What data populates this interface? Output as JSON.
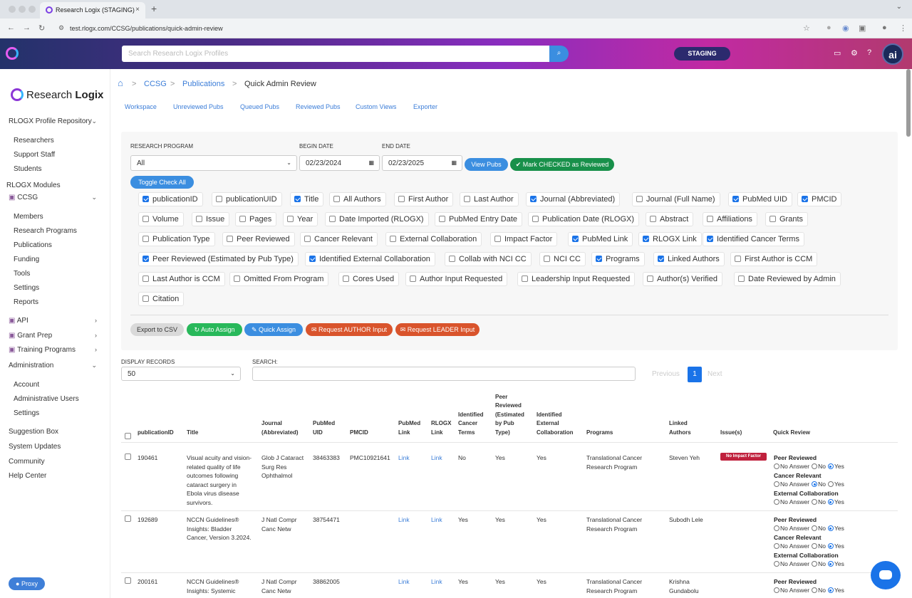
{
  "browser": {
    "tab_title": "Research Logix (STAGING)",
    "tab_close": "×",
    "new_tab": "+",
    "url": "test.rlogx.com/CCSG/publications/quick-admin-review",
    "back_icon": "←",
    "forward_icon": "→",
    "reload_icon": "↻",
    "site_icon": "⚙",
    "star_icon": "☆",
    "menu_chevron": "⌄"
  },
  "header": {
    "search_placeholder": "Search Research Logix Profiles",
    "search_icon": "⌕",
    "env_badge": "STAGING",
    "ai_badge": "ai",
    "icons": {
      "chat": "▭",
      "gear": "⚙",
      "help": "?"
    }
  },
  "sidebar": {
    "brand_light": "Research",
    "brand_bold": "Logix",
    "repo_label": "RLOGX Profile Repository",
    "repo_items": [
      "Researchers",
      "Support Staff",
      "Students"
    ],
    "modules_label": "RLOGX Modules",
    "ccsg_label": "CCSG",
    "ccsg_items": [
      "Members",
      "Research Programs",
      "Publications",
      "Funding",
      "Tools",
      "Settings",
      "Reports"
    ],
    "api_label": "API",
    "grant_prep_label": "Grant Prep",
    "training_label": "Training Programs",
    "admin_label": "Administration",
    "admin_items": [
      "Account",
      "Administrative Users",
      "Settings"
    ],
    "bottom_items": [
      "Suggestion Box",
      "System Updates",
      "Community",
      "Help Center"
    ],
    "proxy_label": "Proxy",
    "arrow_down": "⌄",
    "arrow_right": "›"
  },
  "breadcrumb": {
    "home_icon": "⌂",
    "sep": ">",
    "items": [
      "CCSG",
      "Publications",
      "Quick Admin Review"
    ]
  },
  "subtabs": [
    "Workspace",
    "Unreviewed Pubs",
    "Queued Pubs",
    "Reviewed Pubs",
    "Custom Views",
    "Exporter"
  ],
  "filters": {
    "program_label": "RESEARCH PROGRAM",
    "program_value": "All",
    "begin_label": "BEGIN DATE",
    "begin_value": "02/23/2024",
    "end_label": "END DATE",
    "end_value": "02/23/2025",
    "calendar_icon": "▦",
    "caret": "⌄",
    "view_pubs": "View Pubs",
    "mark_checked": "Mark CHECKED as Reviewed",
    "toggle_all": "Toggle Check All",
    "columns": [
      {
        "label": "publicationID",
        "checked": true
      },
      {
        "label": "publicationUID",
        "checked": false
      },
      {
        "label": "Title",
        "checked": true
      },
      {
        "label": "All Authors",
        "checked": false
      },
      {
        "label": "First Author",
        "checked": false
      },
      {
        "label": "Last Author",
        "checked": false
      },
      {
        "label": "Journal (Abbreviated)",
        "checked": true
      },
      {
        "label": "Journal (Full Name)",
        "checked": false
      },
      {
        "label": "PubMed UID",
        "checked": true
      },
      {
        "label": "PMCID",
        "checked": true
      },
      {
        "label": "Volume",
        "checked": false
      },
      {
        "label": "Issue",
        "checked": false
      },
      {
        "label": "Pages",
        "checked": false
      },
      {
        "label": "Year",
        "checked": false
      },
      {
        "label": "Date Imported (RLOGX)",
        "checked": false
      },
      {
        "label": "PubMed Entry Date",
        "checked": false
      },
      {
        "label": "Publication Date (RLOGX)",
        "checked": false
      },
      {
        "label": "Abstract",
        "checked": false
      },
      {
        "label": "Affiliations",
        "checked": false
      },
      {
        "label": "Grants",
        "checked": false
      },
      {
        "label": "Publication Type",
        "checked": false
      },
      {
        "label": "Peer Reviewed",
        "checked": false
      },
      {
        "label": "Cancer Relevant",
        "checked": false
      },
      {
        "label": "External Collaboration",
        "checked": false
      },
      {
        "label": "Impact Factor",
        "checked": false
      },
      {
        "label": "PubMed Link",
        "checked": true
      },
      {
        "label": "RLOGX Link",
        "checked": true
      },
      {
        "label": "Identified Cancer Terms",
        "checked": true
      },
      {
        "label": "Peer Reviewed (Estimated by Pub Type)",
        "checked": true
      },
      {
        "label": "Identified External Collaboration",
        "checked": true
      },
      {
        "label": "Collab with NCI CC",
        "checked": false
      },
      {
        "label": "NCI CC",
        "checked": false
      },
      {
        "label": "Programs",
        "checked": true
      },
      {
        "label": "Linked Authors",
        "checked": true
      },
      {
        "label": "First Author is CCM",
        "checked": false
      },
      {
        "label": "Last Author is CCM",
        "checked": false
      },
      {
        "label": "Omitted From Program",
        "checked": false
      },
      {
        "label": "Cores Used",
        "checked": false
      },
      {
        "label": "Author Input Requested",
        "checked": false
      },
      {
        "label": "Leadership Input Requested",
        "checked": false
      },
      {
        "label": "Author(s) Verified",
        "checked": false
      },
      {
        "label": "Date Reviewed by Admin",
        "checked": false
      },
      {
        "label": "Citation",
        "checked": false
      }
    ],
    "actions": {
      "export_csv": "Export to CSV",
      "auto_assign": "Auto Assign",
      "quick_assign": "Quick Assign",
      "request_author": "Request AUTHOR Input",
      "request_leader": "Request LEADER Input"
    }
  },
  "table_controls": {
    "display_label": "DISPLAY RECORDS",
    "display_value": "50",
    "search_label": "SEARCH:",
    "previous": "Previous",
    "page": "1",
    "next": "Next"
  },
  "table": {
    "headers": {
      "publicationID": "publicationID",
      "title": "Title",
      "journal": "Journal\n(Abbreviated)",
      "pubmed_uid": "PubMed\nUID",
      "pmcid": "PMCID",
      "pubmed_link": "PubMed\nLink",
      "rlogx_link": "RLOGX\nLink",
      "cancer_terms": "Identified\nCancer\nTerms",
      "peer_est": "Peer\nReviewed\n(Estimated\nby Pub\nType)",
      "ext_collab": "Identified\nExternal\nCollaboration",
      "programs": "Programs",
      "linked_authors": "Linked\nAuthors",
      "issues": "Issue(s)",
      "quick_review": "Quick Review"
    },
    "rows": [
      {
        "id": "190461",
        "title": "Visual acuity and vision-related quality of life outcomes following cataract surgery in Ebola virus disease survivors.",
        "journal": "Glob J Cataract Surg Res Ophthalmol",
        "pubmed_uid": "38463383",
        "pmcid": "PMC10921641",
        "pubmed_link": "Link",
        "rlogx_link": "Link",
        "cancer_terms": "No",
        "peer_est": "Yes",
        "ext_collab": "Yes",
        "programs": "Translational Cancer Research Program",
        "authors": "Steven Yeh",
        "issue": "No Impact Factor"
      },
      {
        "id": "192689",
        "title": "NCCN Guidelines® Insights: Bladder Cancer, Version 3.2024.",
        "journal": "J Natl Compr Canc Netw",
        "pubmed_uid": "38754471",
        "pmcid": "",
        "pubmed_link": "Link",
        "rlogx_link": "Link",
        "cancer_terms": "Yes",
        "peer_est": "Yes",
        "ext_collab": "Yes",
        "programs": "Translational Cancer Research Program",
        "authors": "Subodh Lele",
        "issue": ""
      },
      {
        "id": "200161",
        "title": "NCCN Guidelines® Insights: Systemic Mastocytosis, Version",
        "journal": "J Natl Compr Canc Netw",
        "pubmed_uid": "38862005",
        "pmcid": "",
        "pubmed_link": "Link",
        "rlogx_link": "Link",
        "cancer_terms": "Yes",
        "peer_est": "Yes",
        "ext_collab": "Yes",
        "programs": "Translational Cancer Research Program",
        "authors": "Krishna Gundabolu",
        "issue": ""
      }
    ],
    "quick_review": {
      "peer_reviewed": "Peer Reviewed",
      "cancer_relevant": "Cancer Relevant",
      "external_collab": "External Collaboration",
      "opt_no_answer": "No Answer",
      "opt_no": "No",
      "opt_yes": "Yes"
    }
  }
}
